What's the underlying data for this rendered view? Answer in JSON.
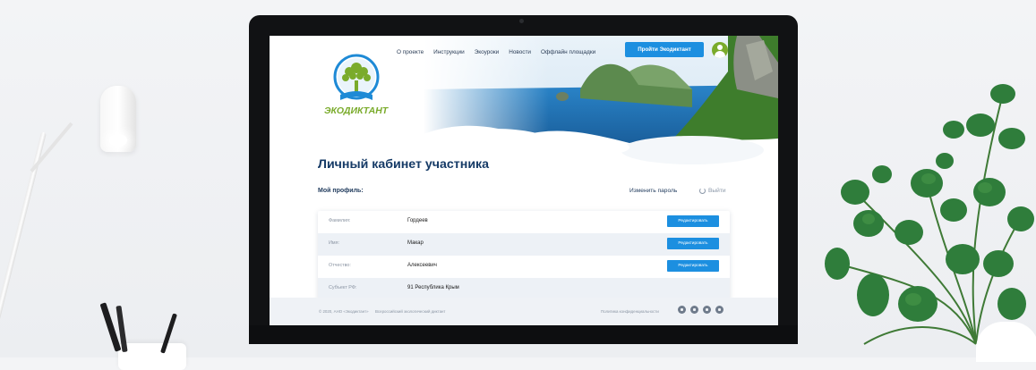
{
  "logo_text": "ЭКОДИКТАНТ",
  "nav": {
    "items": [
      "О проекте",
      "Инструкции",
      "Экоуроки",
      "Новости",
      "Оффлайн площадки"
    ],
    "cta_label": "Пройти Экодиктант"
  },
  "page": {
    "title": "Личный кабинет участника",
    "profile_label": "Мой профиль:",
    "change_password": "Изменить пароль",
    "logout": "Выйти"
  },
  "profile": {
    "rows": [
      {
        "label": "Фамилия:",
        "value": "Гордеев",
        "button": "Редактировать"
      },
      {
        "label": "Имя:",
        "value": "Макар",
        "button": "Редактировать"
      },
      {
        "label": "Отчество:",
        "value": "Алексеевич",
        "button": "Редактировать"
      },
      {
        "label": "Субъект РФ:",
        "value": "91 Республика Крым"
      }
    ]
  },
  "footer": {
    "copyright": "© 2020, АНО «Экодиктант»",
    "project": "Всероссийский экологический диктант",
    "policy": "Политика конфиденциальности",
    "socials": [
      "instagram-icon",
      "facebook-icon",
      "vk-icon",
      "youtube-icon"
    ]
  },
  "colors": {
    "brand_blue": "#1c8fe0",
    "title_navy": "#153a66",
    "logo_green": "#7aab2b"
  }
}
